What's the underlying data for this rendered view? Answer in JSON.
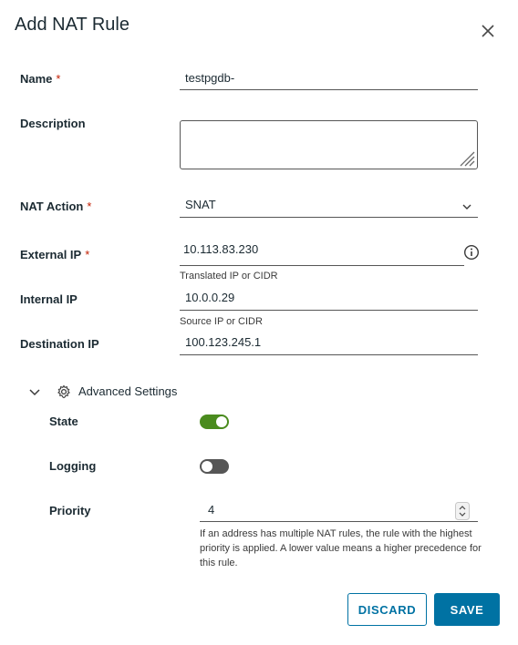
{
  "modal": {
    "title": "Add NAT Rule"
  },
  "fields": {
    "name": {
      "label": "Name",
      "required": "*",
      "value": "testpgdb-"
    },
    "description": {
      "label": "Description",
      "value": ""
    },
    "nat_action": {
      "label": "NAT Action",
      "required": "*",
      "value": "SNAT"
    },
    "external_ip": {
      "label": "External IP",
      "required": "*",
      "value": "10.113.83.230",
      "helper": "Translated IP or CIDR"
    },
    "internal_ip": {
      "label": "Internal IP",
      "value": "10.0.0.29",
      "helper": "Source IP or CIDR"
    },
    "destination_ip": {
      "label": "Destination IP",
      "value": "100.123.245.1"
    }
  },
  "advanced": {
    "label": "Advanced Settings",
    "state": {
      "label": "State",
      "on": true
    },
    "logging": {
      "label": "Logging",
      "on": false
    },
    "priority": {
      "label": "Priority",
      "value": "4",
      "helper": "If an address has multiple NAT rules, the rule with the highest priority is applied. A lower value means a higher precedence for this rule."
    }
  },
  "buttons": {
    "discard": "DISCARD",
    "save": "SAVE"
  },
  "colors": {
    "accent": "#0072a3",
    "toggle_on": "#4a8b1e",
    "toggle_off": "#565656",
    "required": "#c21d00"
  }
}
